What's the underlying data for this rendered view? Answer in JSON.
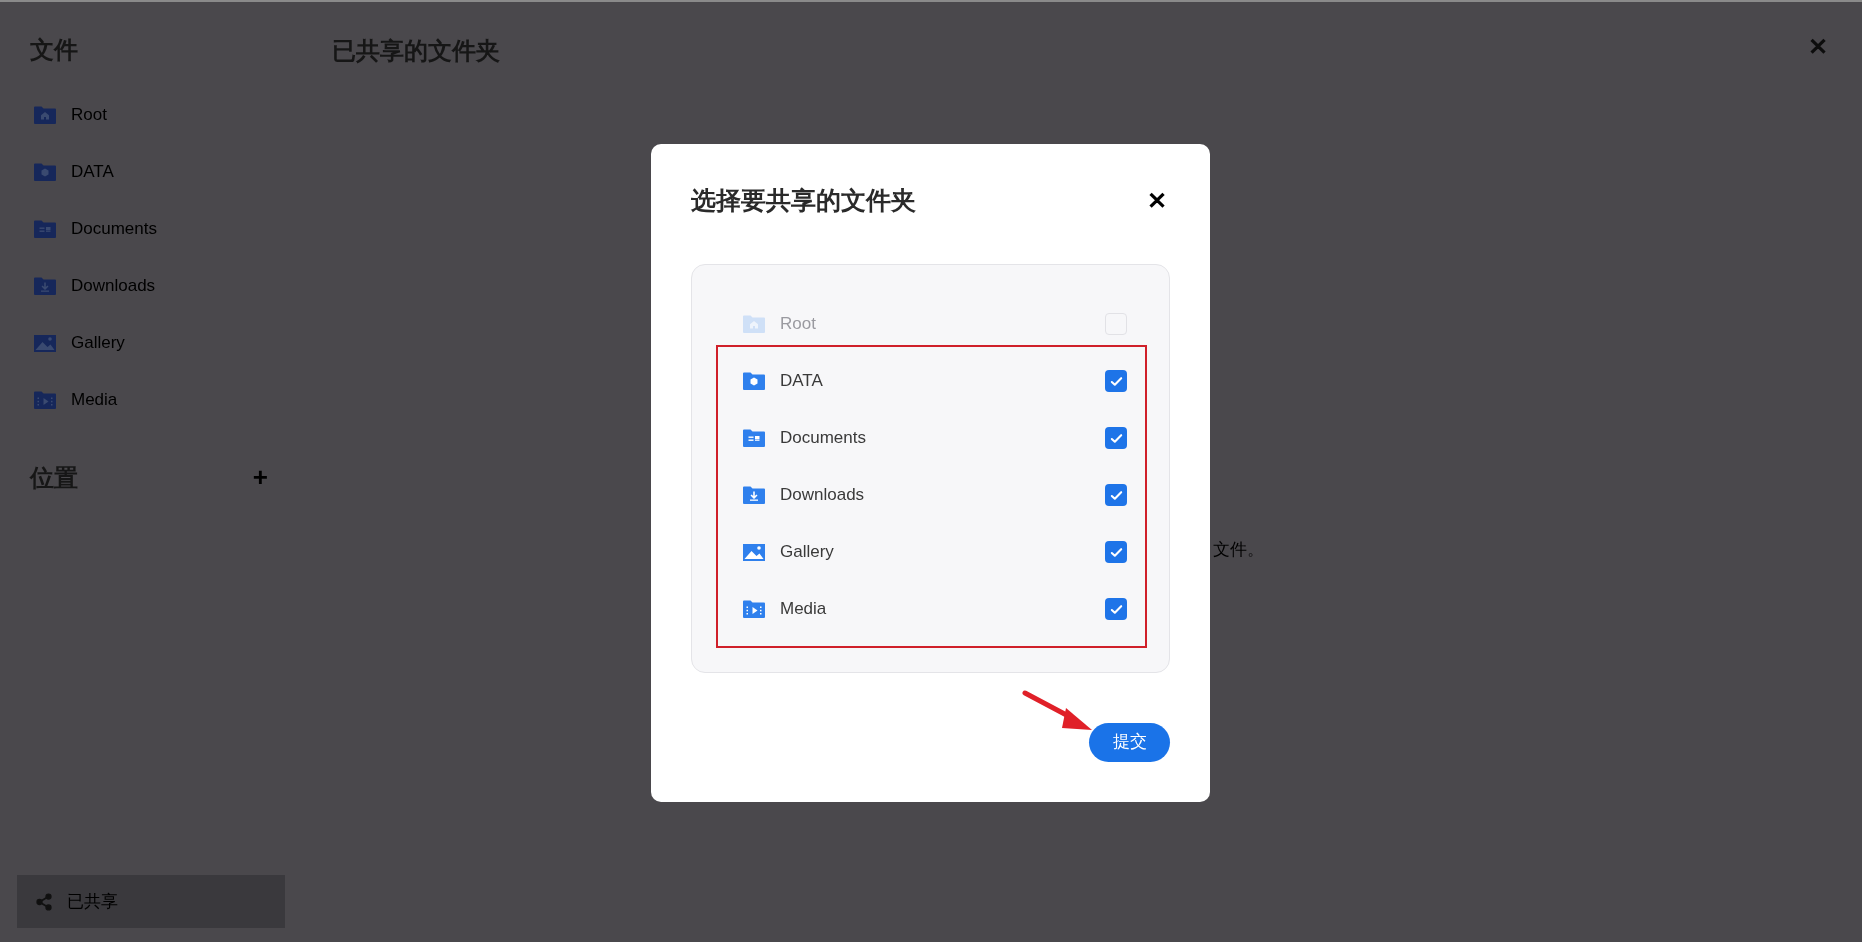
{
  "sidebar": {
    "title": "文件",
    "items": [
      {
        "label": "Root"
      },
      {
        "label": "DATA"
      },
      {
        "label": "Documents"
      },
      {
        "label": "Downloads"
      },
      {
        "label": "Gallery"
      },
      {
        "label": "Media"
      }
    ],
    "section": {
      "title": "位置",
      "add": "+"
    },
    "shared": {
      "label": "已共享",
      "selected": true
    }
  },
  "header": {
    "title": "已共享的文件夹",
    "close": "✕"
  },
  "empty_text": "文件。",
  "dialog": {
    "title": "选择要共享的文件夹",
    "close": "✕",
    "folders": [
      {
        "label": "Root",
        "checked": false,
        "disabled": true
      },
      {
        "label": "DATA",
        "checked": true,
        "disabled": false
      },
      {
        "label": "Documents",
        "checked": true,
        "disabled": false
      },
      {
        "label": "Downloads",
        "checked": true,
        "disabled": false
      },
      {
        "label": "Gallery",
        "checked": true,
        "disabled": false
      },
      {
        "label": "Media",
        "checked": true,
        "disabled": false
      }
    ],
    "submit": "提交"
  }
}
